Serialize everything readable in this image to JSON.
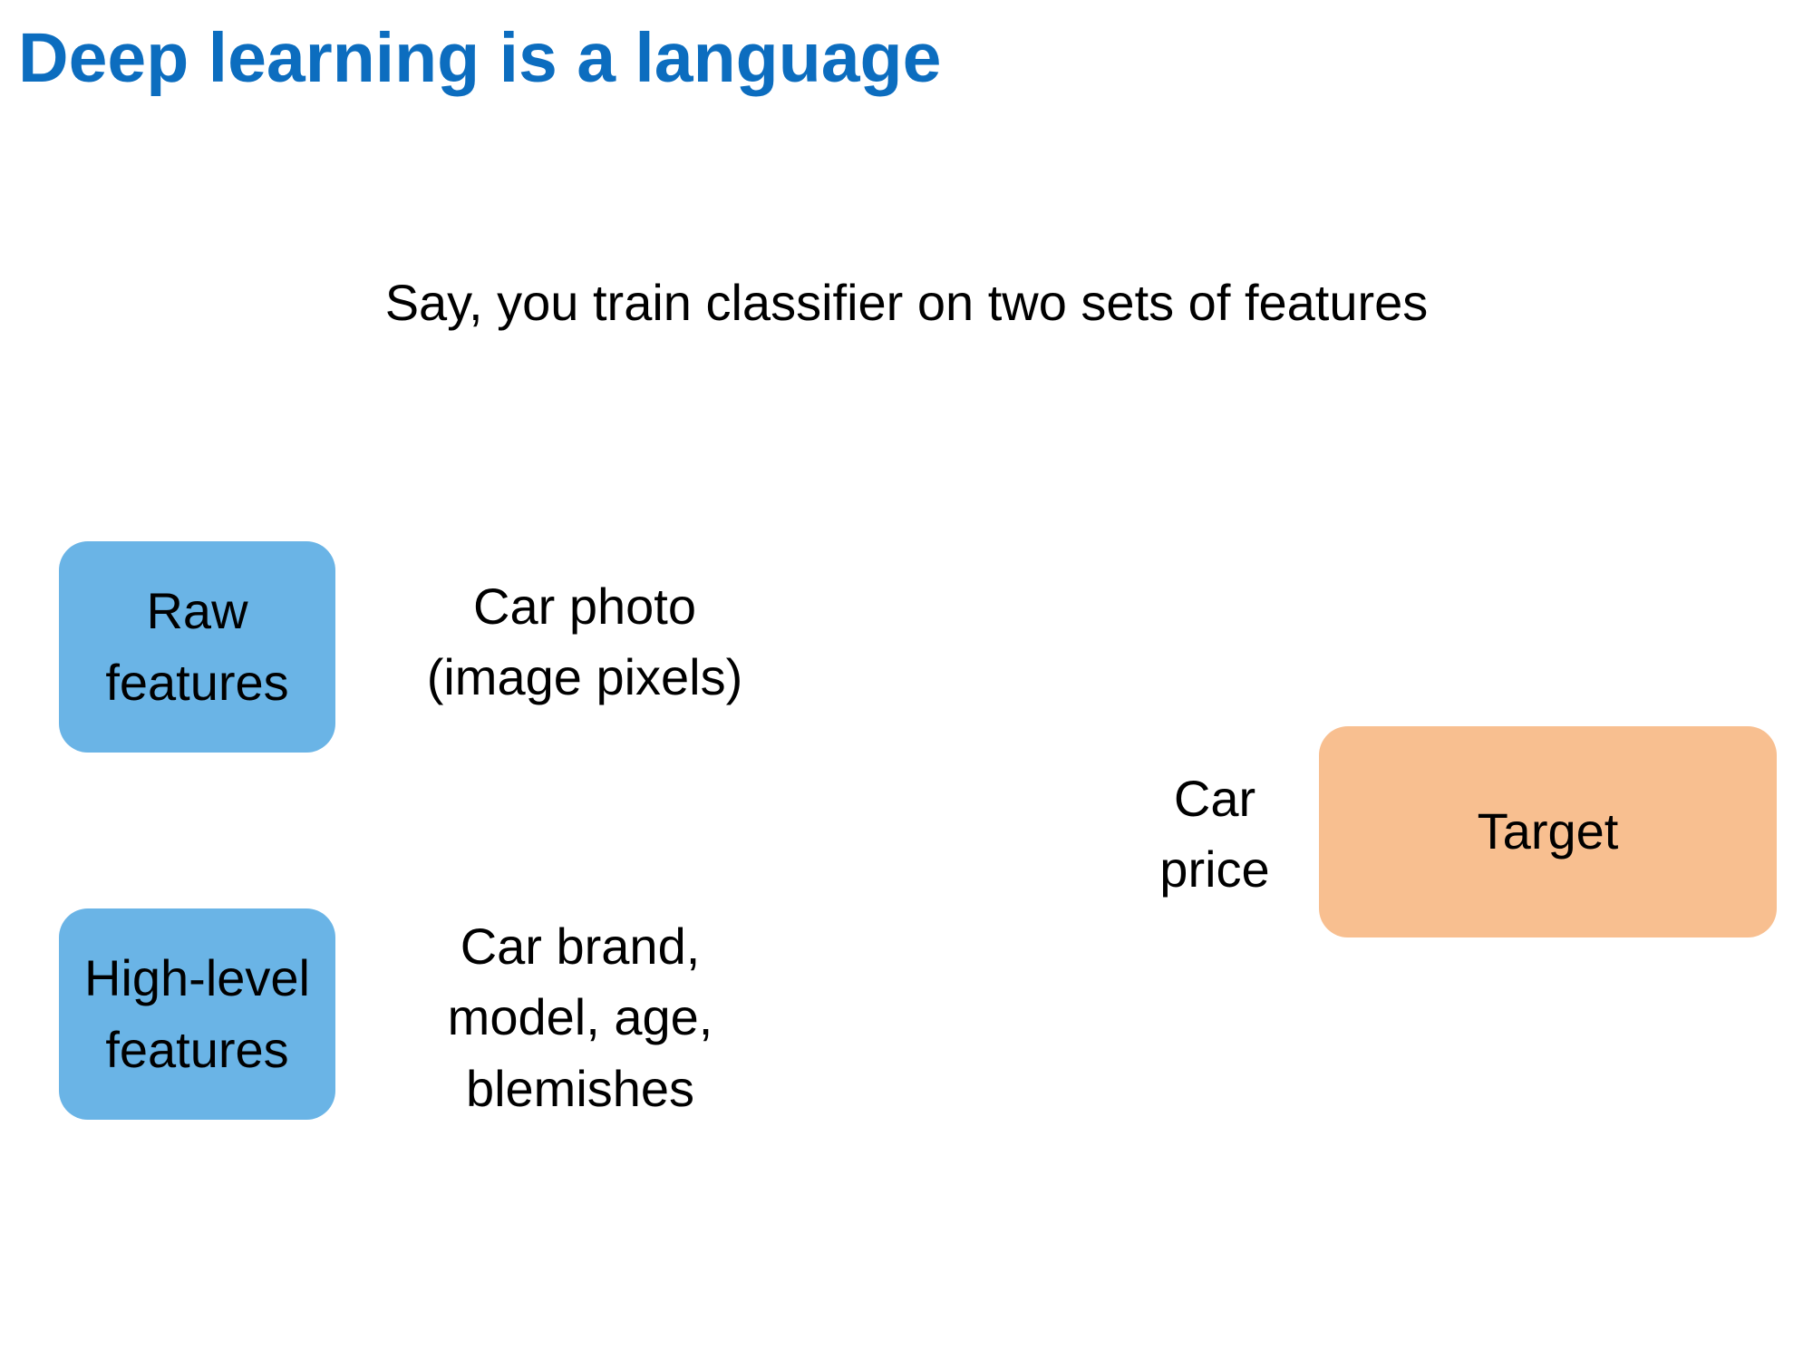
{
  "title": "Deep learning is a language",
  "subtitle": "Say, you train classifier on two sets of features",
  "colors": {
    "title": "#0c6dbf",
    "feature_box": "#6ab4e6",
    "target_box": "#f8bf90",
    "text": "#000000"
  },
  "features": [
    {
      "box_label": "Raw\nfeatures",
      "description": "Car photo\n(image pixels)"
    },
    {
      "box_label": "High-level\nfeatures",
      "description": "Car brand,\nmodel, age,\nblemishes"
    }
  ],
  "target": {
    "box_label": "Target",
    "description": "Car\nprice"
  }
}
